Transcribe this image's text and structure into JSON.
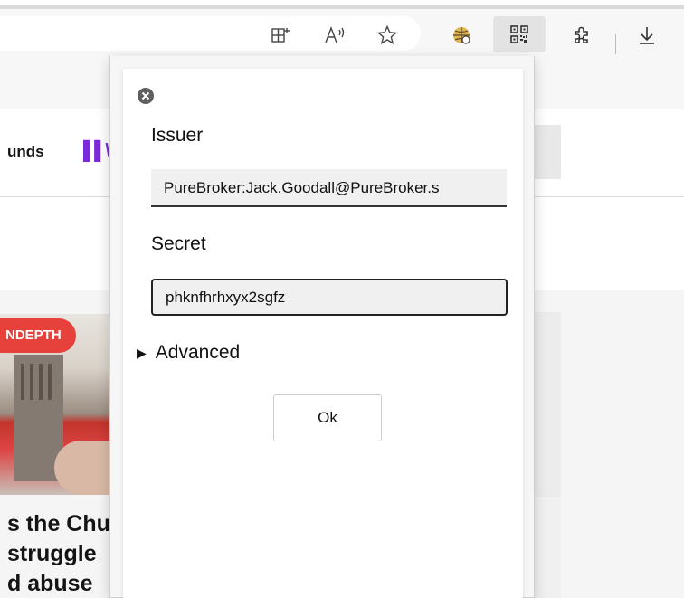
{
  "browser": {
    "toolbar_icons": [
      "split-screen-icon",
      "read-aloud-icon",
      "favorite-star-icon",
      "extension-globe-icon",
      "qr-code-icon",
      "extensions-puzzle-icon",
      "download-icon"
    ]
  },
  "background_page": {
    "nav_text": "unds",
    "badge": "NDEPTH",
    "headline": [
      "s the Chu",
      "struggle",
      "d abuse"
    ]
  },
  "popup": {
    "close_icon": "close-icon",
    "issuer_label": "Issuer",
    "issuer_value": "PureBroker:Jack.Goodall@PureBroker.s",
    "secret_label": "Secret",
    "secret_value": "phknfhrhxyx2sgfz",
    "advanced_label": "Advanced",
    "ok_label": "Ok"
  }
}
